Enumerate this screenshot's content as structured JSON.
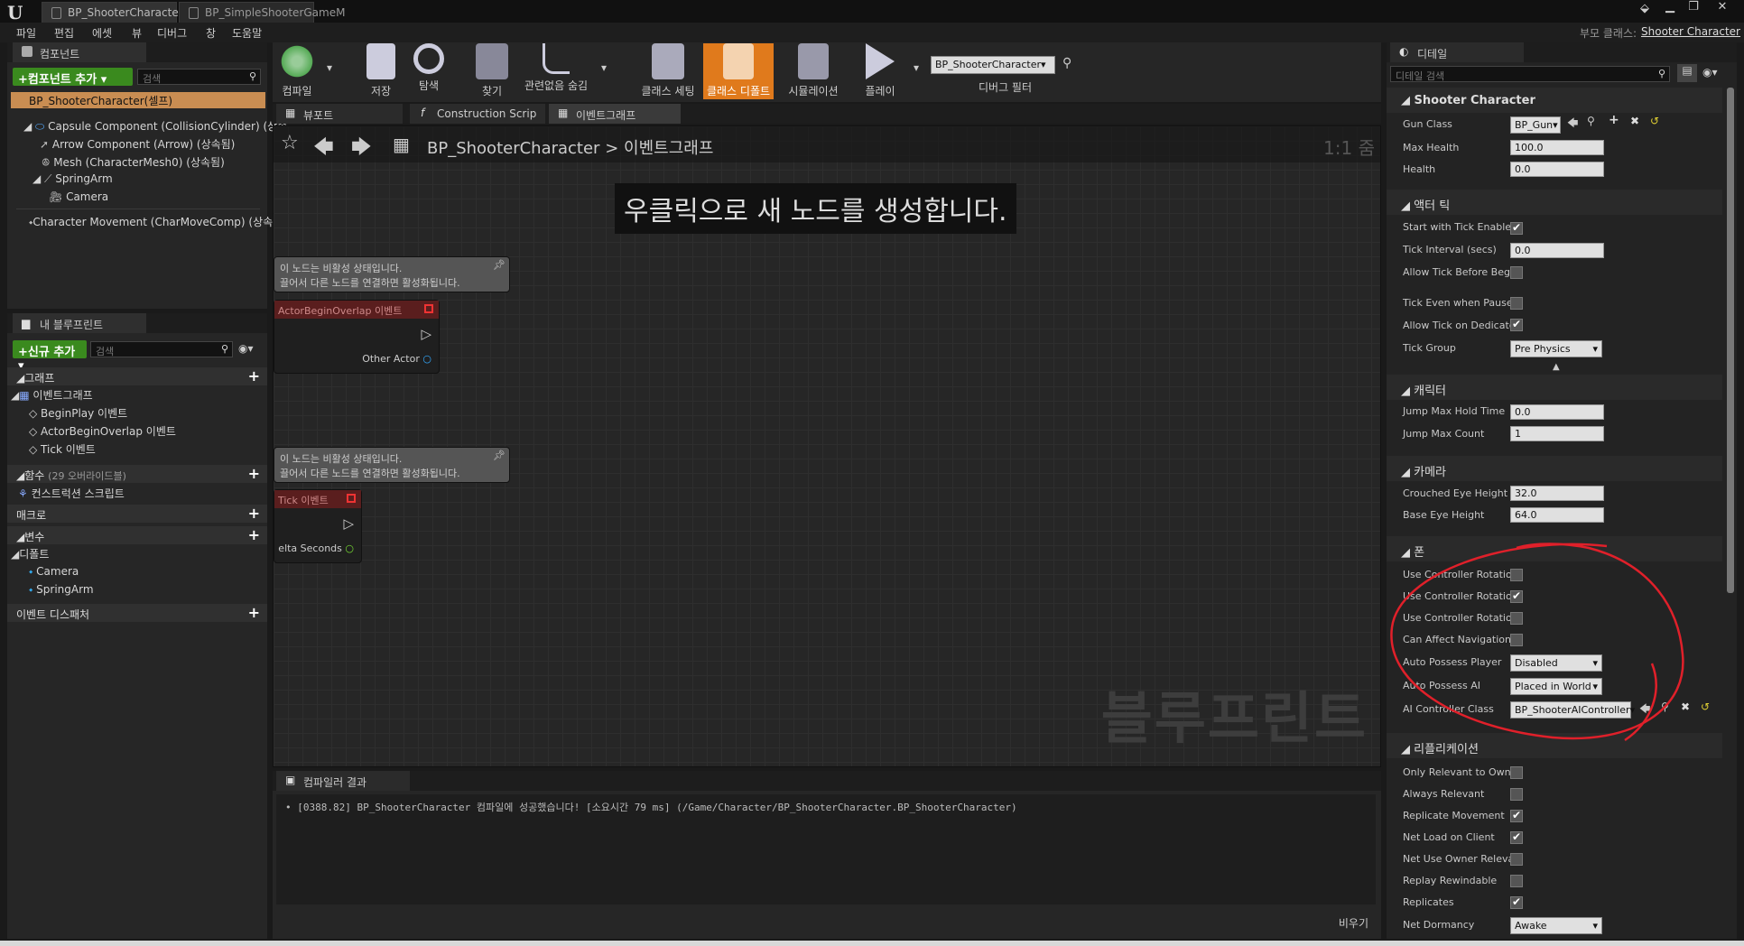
{
  "window": {
    "tabs": [
      "BP_ShooterCharacter",
      "BP_SimpleShooterGameM"
    ],
    "parent_class_label": "부모 클래스:",
    "parent_class": "Shooter Character"
  },
  "menu": [
    "파일",
    "편집",
    "에셋",
    "뷰",
    "디버그",
    "창",
    "도움말"
  ],
  "components": {
    "title": "컴포넌트",
    "add_button": "+컴포넌트 추가 ▾",
    "search_placeholder": "검색",
    "root": "BP_ShooterCharacter(셀프)",
    "items": [
      "Capsule Component (CollisionCylinder) (상속",
      "Arrow Component (Arrow) (상속됨)",
      "Mesh (CharacterMesh0) (상속됨)",
      "SpringArm",
      "Camera",
      "Character Movement (CharMoveComp) (상속"
    ]
  },
  "myblueprint": {
    "title": "내 블루프린트",
    "add_button": "+신규 추가 ▾",
    "search_placeholder": "검색",
    "graphs_label": "그래프",
    "eventgraph": "이벤트그래프",
    "events": [
      "BeginPlay 이벤트",
      "ActorBeginOverlap 이벤트",
      "Tick 이벤트"
    ],
    "functions_label": "함수",
    "functions_note": "(29 오버라이드블)",
    "construction": "컨스트럭션 스크립트",
    "macros": "매크로",
    "variables": "변수",
    "default_label": "디폴트",
    "vars": [
      "Camera",
      "SpringArm"
    ],
    "dispatchers": "이벤트 디스패처"
  },
  "toolbar": {
    "buttons": [
      "컴파일",
      "저장",
      "탐색",
      "찾기",
      "관련없음 숨김",
      "클래스 세팅",
      "클래스 디폴트",
      "시뮬레이션",
      "플레이"
    ],
    "debug_object": "BP_ShooterCharacter▾",
    "debug_filter": "디버그 필터"
  },
  "graph": {
    "tabs": [
      "뷰포트",
      "Construction Scrip",
      "이벤트그래프"
    ],
    "breadcrumb_root": "BP_ShooterCharacter",
    "breadcrumb_sep": ">",
    "breadcrumb_leaf": "이벤트그래프",
    "zoom": "1:1 줌",
    "hint": "우클릭으로 새 노드를 생성합니다.",
    "watermark": "블루프린트",
    "disabled_line1": "이 노드는 비활성 상태입니다.",
    "disabled_line2": "끌어서 다른 노드를 연결하면 활성화됩니다.",
    "node1_title": "ActorBeginOverlap 이벤트",
    "node1_pin": "Other Actor",
    "node2_title": "Tick 이벤트",
    "node2_pin": "elta Seconds"
  },
  "compiler": {
    "title": "컴파일러 결과",
    "message": "[0388.82] BP_ShooterCharacter 컴파일에 성공했습니다! [소요시간 79 ms] (/Game/Character/BP_ShooterCharacter.BP_ShooterCharacter)",
    "clear": "비우기"
  },
  "details": {
    "title": "디테일",
    "search_placeholder": "디테일 검색",
    "sec_shooter": "Shooter Character",
    "gun_class_label": "Gun Class",
    "gun_class": "BP_Gun▾",
    "max_health_label": "Max Health",
    "max_health": "100.0",
    "health_label": "Health",
    "health": "0.0",
    "sec_tick": "액터 틱",
    "tick_labels": [
      "Start with Tick Enablec",
      "Tick Interval (secs)",
      "Allow Tick Before Begi",
      "Tick Even when Pausec",
      "Allow Tick on Dedicate",
      "Tick Group"
    ],
    "tick_interval": "0.0",
    "tick_group": "Pre Physics",
    "sec_char": "캐릭터",
    "jump_hold_label": "Jump Max Hold Time",
    "jump_hold": "0.0",
    "jump_count_label": "Jump Max Count",
    "jump_count": "1",
    "sec_cam": "카메라",
    "crouch_label": "Crouched Eye Height",
    "crouch": "32.0",
    "base_eye_label": "Base Eye Height",
    "base_eye": "64.0",
    "sec_pawn": "폰",
    "pawn_labels": [
      "Use Controller Rotatior",
      "Use Controller Rotatior",
      "Use Controller Rotatior",
      "Can Affect Navigation",
      "Auto Possess Player",
      "Auto Possess AI",
      "AI Controller Class"
    ],
    "auto_player": "Disabled",
    "auto_ai": "Placed in World",
    "ai_class": "BP_ShooterAIController▾",
    "sec_rep": "리플리케이션",
    "rep_labels": [
      "Only Relevant to Owne",
      "Always Relevant",
      "Replicate Movement",
      "Net Load on Client",
      "Net Use Owner Relevai",
      "Replay Rewindable",
      "Replicates",
      "Net Dormancy"
    ],
    "net_dormancy": "Awake"
  },
  "colors": {
    "accent": "#e07a1c",
    "green": "#3a8a1e",
    "annotation": "#e0202a"
  }
}
